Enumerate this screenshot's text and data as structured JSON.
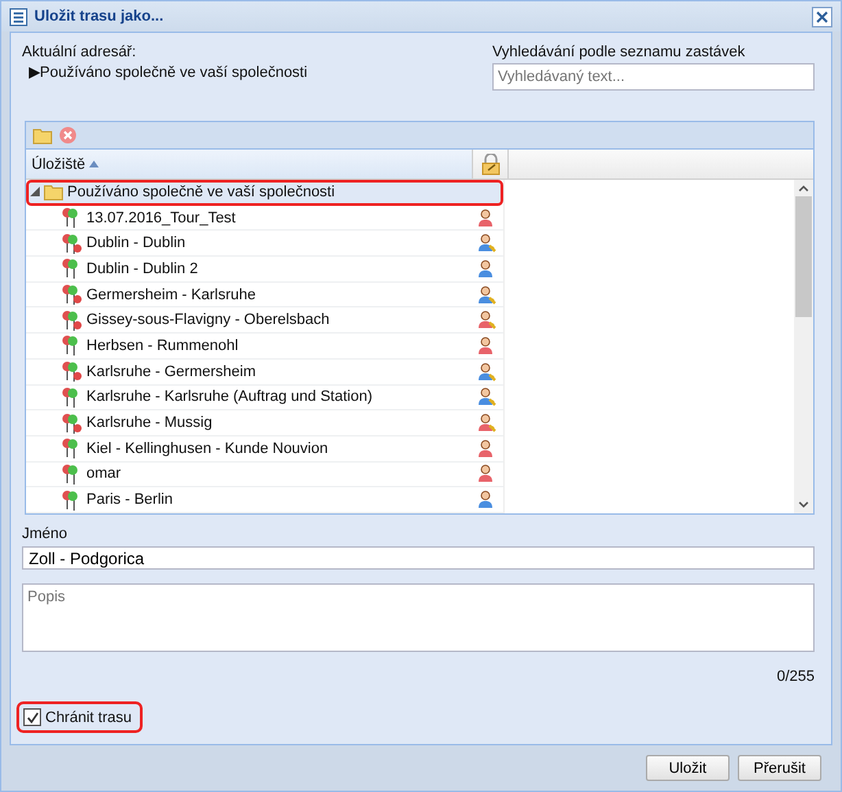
{
  "window": {
    "title": "Uložit trasu jako..."
  },
  "current_dir": {
    "label": "Aktuální adresář:",
    "path": "▶Používáno společně ve vaší společnosti"
  },
  "search": {
    "label": "Vyhledávání podle seznamu zastávek",
    "placeholder": "Vyhledávaný text..."
  },
  "grid": {
    "columns": [
      "Úložiště"
    ],
    "root": {
      "label": "Používáno společně ve vaší společnosti",
      "expanded": true,
      "selected": true,
      "children": [
        {
          "label": "13.07.2016_Tour_Test",
          "blocked": false,
          "kind": "user",
          "shared": false
        },
        {
          "label": "Dublin - Dublin",
          "blocked": true,
          "kind": "group",
          "shared": true
        },
        {
          "label": "Dublin - Dublin 2",
          "blocked": false,
          "kind": "group",
          "shared": false
        },
        {
          "label": "Germersheim - Karlsruhe",
          "blocked": true,
          "kind": "group",
          "shared": true
        },
        {
          "label": "Gissey-sous-Flavigny - Oberelsbach",
          "blocked": true,
          "kind": "user",
          "shared": true
        },
        {
          "label": "Herbsen - Rummenohl",
          "blocked": false,
          "kind": "user",
          "shared": false
        },
        {
          "label": "Karlsruhe - Germersheim",
          "blocked": true,
          "kind": "group",
          "shared": true
        },
        {
          "label": "Karlsruhe - Karlsruhe (Auftrag und Station)",
          "blocked": false,
          "kind": "group",
          "shared": true
        },
        {
          "label": "Karlsruhe - Mussig",
          "blocked": true,
          "kind": "user",
          "shared": true
        },
        {
          "label": "Kiel - Kellinghusen - Kunde Nouvion",
          "blocked": false,
          "kind": "user",
          "shared": false
        },
        {
          "label": "omar",
          "blocked": false,
          "kind": "user",
          "shared": false
        },
        {
          "label": "Paris - Berlin",
          "blocked": false,
          "kind": "group",
          "shared": false
        }
      ]
    }
  },
  "name": {
    "label": "Jméno",
    "value": "Zoll - Podgorica"
  },
  "description": {
    "placeholder": "Popis",
    "counter": "0/255"
  },
  "protect": {
    "label": "Chránit trasu",
    "checked": true
  },
  "buttons": [
    "Uložit",
    "Přerušit"
  ]
}
